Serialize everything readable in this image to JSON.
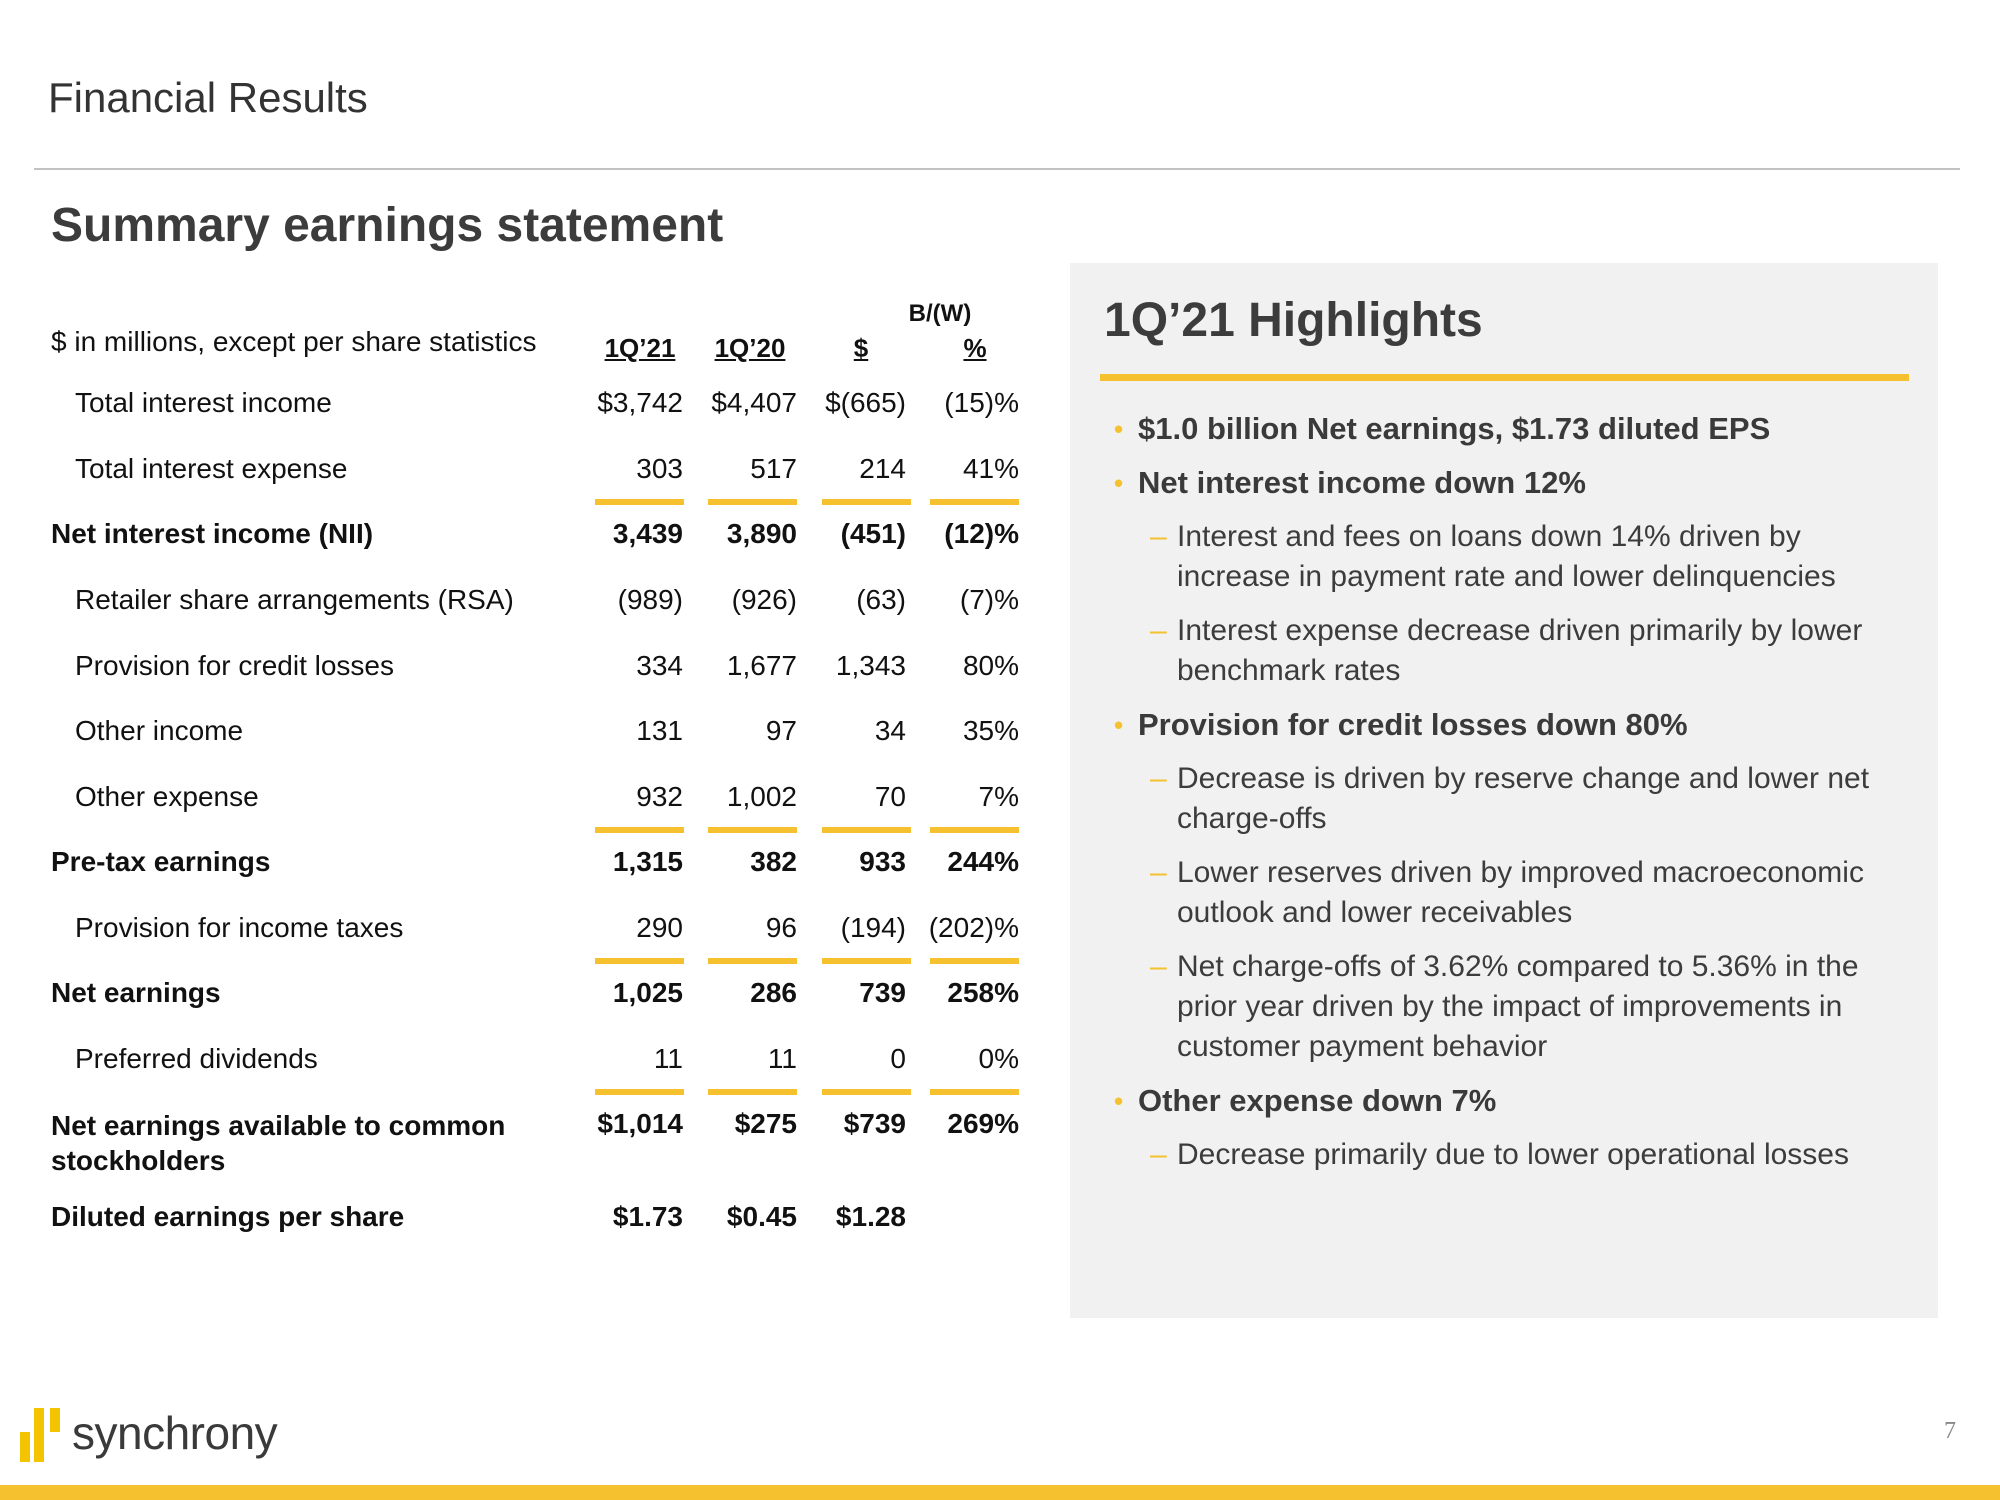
{
  "header": {
    "title": "Financial Results",
    "section_title": "Summary earnings statement"
  },
  "table": {
    "units_label": "$ in millions, except per share statistics",
    "bw_label": "B/(W)",
    "columns": [
      "1Q’21",
      "1Q’20",
      "$",
      "%"
    ],
    "rows": [
      {
        "label": "Total interest income",
        "style": "indent",
        "values": [
          "$3,742",
          "$4,407",
          "$(665)",
          "(15)%"
        ]
      },
      {
        "label": "Total interest expense",
        "style": "indent",
        "values": [
          "303",
          "517",
          "214",
          "41%"
        ]
      },
      {
        "label": "Net interest income (NII)",
        "style": "bold",
        "values": [
          "3,439",
          "3,890",
          "(451)",
          "(12)%"
        ]
      },
      {
        "label": "Retailer share arrangements (RSA)",
        "style": "indent",
        "values": [
          "(989)",
          "(926)",
          "(63)",
          "(7)%"
        ]
      },
      {
        "label": "Provision for credit losses",
        "style": "indent",
        "values": [
          "334",
          "1,677",
          "1,343",
          "80%"
        ]
      },
      {
        "label": "Other income",
        "style": "indent",
        "values": [
          "131",
          "97",
          "34",
          "35%"
        ]
      },
      {
        "label": "Other expense",
        "style": "indent",
        "values": [
          "932",
          "1,002",
          "70",
          "7%"
        ]
      },
      {
        "label": "Pre-tax earnings",
        "style": "bold",
        "values": [
          "1,315",
          "382",
          "933",
          "244%"
        ]
      },
      {
        "label": "Provision for income taxes",
        "style": "indent",
        "values": [
          "290",
          "96",
          "(194)",
          "(202)%"
        ]
      },
      {
        "label": "Net earnings",
        "style": "bold",
        "values": [
          "1,025",
          "286",
          "739",
          "258%"
        ]
      },
      {
        "label": "Preferred dividends",
        "style": "indent",
        "values": [
          "11",
          "11",
          "0",
          "0%"
        ]
      },
      {
        "label": "Net earnings available to common stockholders",
        "label_line1": "Net earnings available to common",
        "label_line2": "stockholders",
        "style": "bold",
        "values": [
          "$1,014",
          "$275",
          "$739",
          "269%"
        ]
      },
      {
        "label": "Diluted earnings per share",
        "style": "bold",
        "values": [
          "$1.73",
          "$0.45",
          "$1.28",
          ""
        ]
      }
    ]
  },
  "highlights": {
    "title": "1Q’21 Highlights",
    "items": [
      {
        "text": "$1.0 billion Net earnings, $1.73 diluted EPS",
        "subs": []
      },
      {
        "text": "Net interest income down 12%",
        "subs": [
          "Interest and fees on loans down 14% driven by increase in payment rate and lower delinquencies",
          "Interest expense decrease driven primarily by lower benchmark rates"
        ]
      },
      {
        "text": "Provision for credit losses down 80%",
        "subs": [
          "Decrease is driven by reserve change and lower net charge-offs",
          "Lower reserves driven by improved macroeconomic outlook and lower receivables",
          "Net charge-offs of 3.62% compared to 5.36% in the prior year driven by the impact of improvements in customer payment behavior"
        ]
      },
      {
        "text": "Other expense down 7%",
        "subs": [
          "Decrease primarily due to lower operational losses"
        ]
      }
    ]
  },
  "footer": {
    "logo_text": "synchrony",
    "page_number": "7"
  },
  "colors": {
    "accent": "#f5c12e",
    "panel_bg": "#f1f1f1",
    "heading": "#3c3c3c"
  }
}
